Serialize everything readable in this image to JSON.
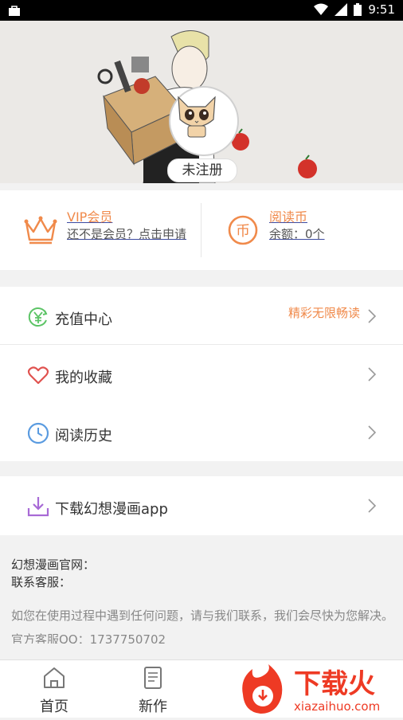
{
  "status_bar": {
    "time": "9:51"
  },
  "profile": {
    "register_label": "未注册"
  },
  "membership": {
    "vip": {
      "title": "VIP会员",
      "subtitle": "还不是会员？点击申请"
    },
    "coins": {
      "title": "阅读币",
      "subtitle": "余额：0个"
    }
  },
  "menu": [
    {
      "label": "充值中心",
      "note": "精彩无限畅读",
      "icon": "recharge-yen-icon"
    },
    {
      "label": "我的收藏",
      "icon": "heart-icon"
    },
    {
      "label": "阅读历史",
      "icon": "clock-icon"
    }
  ],
  "download": {
    "label": "下载幻想漫画app",
    "icon": "download-icon"
  },
  "info": {
    "site_label": "幻想漫画官网：",
    "service_label": "联系客服：",
    "help_text": "如您在使用过程中遇到任何问题，请与我们联系，我们会尽快为您解决。",
    "qq_label": "官方客服QQ：1737750702"
  },
  "tabs": [
    {
      "label": "首页",
      "icon": "home-icon"
    },
    {
      "label": "新作",
      "icon": "new-book-icon"
    }
  ],
  "watermark": {
    "text_cn": "下载火",
    "text_en": "xiazaihuo.com"
  },
  "colors": {
    "accent": "#f08a4b",
    "link_underline": "#3c4aa0",
    "green": "#5cc466",
    "heart": "#e0524f",
    "clock": "#5a9be0",
    "download": "#a86ad6"
  }
}
